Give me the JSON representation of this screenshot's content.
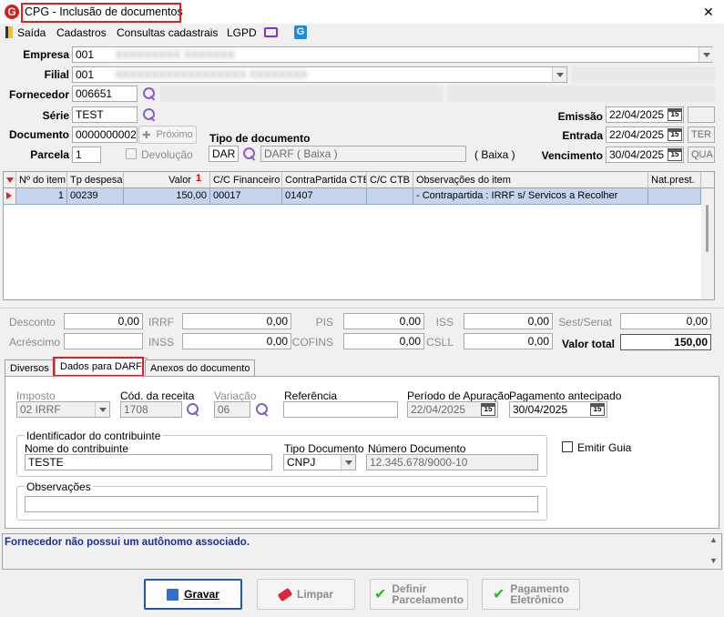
{
  "window": {
    "title": "CPG - Inclusão de documentos",
    "close_glyph": "✕"
  },
  "menu": {
    "items": [
      "Saída",
      "Cadastros",
      "Consultas cadastrais",
      "LGPD"
    ]
  },
  "form": {
    "empresa": {
      "label": "Empresa",
      "value": "001",
      "extra": "XXXXXXXXX XXXXXXX"
    },
    "filial": {
      "label": "Filial",
      "value": "001",
      "extra": "XXXXXXXXXXXXXXXXXX XXXXXXXX"
    },
    "fornecedor": {
      "label": "Fornecedor",
      "value": "006651"
    },
    "serie": {
      "label": "Série",
      "value": "TEST"
    },
    "documento": {
      "label": "Documento",
      "value": "0000000002",
      "proximo": "Próximo"
    },
    "parcela": {
      "label": "Parcela",
      "value": "1",
      "devolucao": "Devolução"
    },
    "tipo_documento": {
      "label": "Tipo de documento",
      "code": "DAR",
      "desc": "DARF ( Baixa )",
      "baixa": "( Baixa )"
    },
    "emissao": {
      "label": "Emissão",
      "value": "22/04/2025"
    },
    "entrada": {
      "label": "Entrada",
      "value": "22/04/2025",
      "extra": "TER"
    },
    "vencimento": {
      "label": "Vencimento",
      "value": "30/04/2025",
      "extra": "QUA"
    }
  },
  "grid": {
    "headers": [
      "Nº do item",
      "Tp despesa",
      "Valor",
      "C/C Financeiro",
      "ContraPartida CTB",
      "C/C CTB",
      "Observações do item",
      "Nat.prest."
    ],
    "sort_indicator": "1",
    "rows": [
      {
        "item": "1",
        "tp_despesa": "00239",
        "valor": "150,00",
        "cc_fin": "00017",
        "contrapartida": "01407",
        "cc_ctb": "",
        "obs": "- Contrapartida : IRRF s/ Servicos a Recolher",
        "nat": ""
      }
    ]
  },
  "totals": {
    "desconto": {
      "label": "Desconto",
      "value": "0,00"
    },
    "acrescimo": {
      "label": "Acréscimo",
      "value": ""
    },
    "irrf": {
      "label": "IRRF",
      "value": "0,00"
    },
    "inss": {
      "label": "INSS",
      "value": "0,00"
    },
    "pis": {
      "label": "PIS",
      "value": "0,00"
    },
    "cofins": {
      "label": "COFINS",
      "value": "0,00"
    },
    "iss": {
      "label": "ISS",
      "value": "0,00"
    },
    "csll": {
      "label": "CSLL",
      "value": "0,00"
    },
    "sest": {
      "label": "Sest/Senat",
      "value": "0,00"
    },
    "valor_total": {
      "label": "Valor total",
      "value": "150,00"
    }
  },
  "tabs": [
    "Diversos",
    "Dados para DARF",
    "Anexos do documento"
  ],
  "darf": {
    "imposto": {
      "label": "Imposto",
      "value": "02 IRRF"
    },
    "cod_receita": {
      "label": "Cód. da receita",
      "value": "1708"
    },
    "variacao": {
      "label": "Variação",
      "value": "06"
    },
    "referencia": {
      "label": "Referência",
      "value": ""
    },
    "periodo": {
      "label": "Período de Apuração",
      "value": "22/04/2025"
    },
    "pagamento": {
      "label": "Pagamento antecipado",
      "value": "30/04/2025"
    },
    "identificador": "Identificador do contribuinte",
    "nome": {
      "label": "Nome do contribuinte",
      "value": "TESTE"
    },
    "tipo_doc": {
      "label": "Tipo Documento",
      "value": "CNPJ"
    },
    "numero_doc": {
      "label": "Número Documento",
      "value": "12.345.678/9000-10"
    },
    "emitir_guia": "Emitir Guia",
    "observacoes": "Observações"
  },
  "status_message": "Fornecedor não possui um autônomo associado.",
  "buttons": {
    "gravar": "Gravar",
    "limpar": "Limpar",
    "definir": [
      "Definir",
      "Parcelamento"
    ],
    "pagamento": [
      "Pagamento",
      "Eletrônico"
    ]
  },
  "colors": {
    "accent": "#d21f1f",
    "selection": "#c6d5ee",
    "status_text": "#1a2fa0"
  }
}
